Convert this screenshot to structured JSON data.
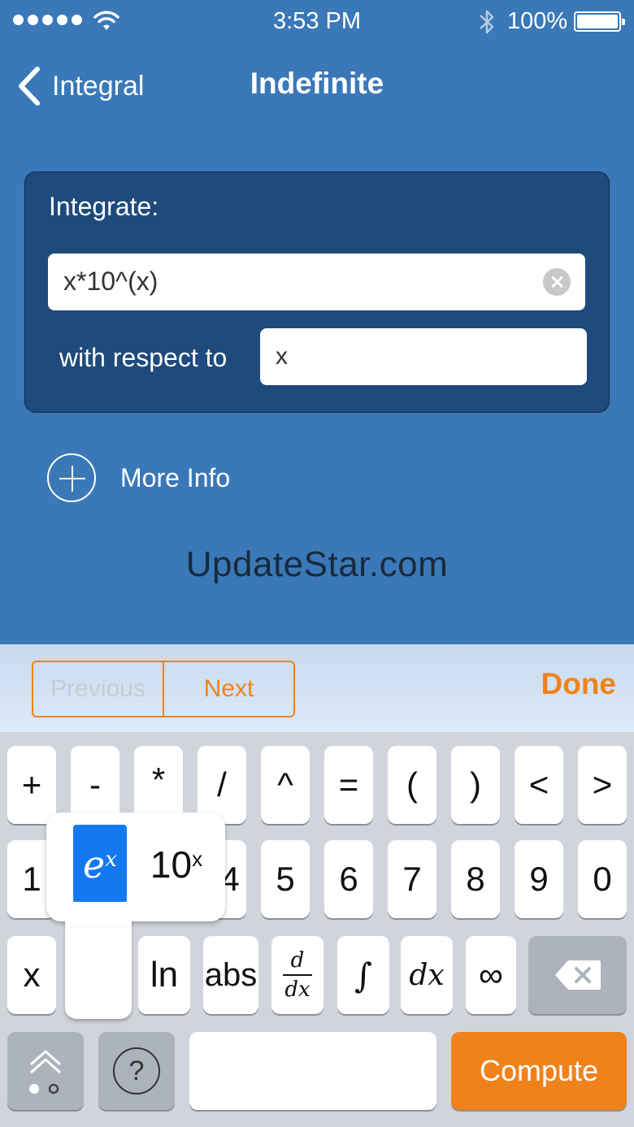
{
  "status_bar": {
    "time": "3:53 PM",
    "battery": "100%"
  },
  "nav": {
    "back_label": "Integral",
    "title": "Indefinite"
  },
  "form": {
    "label": "Integrate:",
    "expression": "x*10^(x)",
    "wrt_label": "with respect to",
    "variable": "x"
  },
  "more_info": {
    "label": "More Info"
  },
  "watermark": "UpdateStar.com",
  "toolbar": {
    "previous_label": "Previous",
    "next_label": "Next",
    "done_label": "Done"
  },
  "keyboard": {
    "row1": [
      "+",
      "-",
      "*",
      "/",
      "^",
      "=",
      "(",
      ")",
      "<",
      ">"
    ],
    "row2": [
      "1",
      "4",
      "5",
      "6",
      "7",
      "8",
      "9",
      "0"
    ],
    "row3": {
      "x": "x",
      "ln": "ln",
      "abs": "abs",
      "d": "d",
      "dx_den": "dx",
      "integral": "∫",
      "dx": "dx",
      "infinity": "∞"
    },
    "compute_label": "Compute",
    "help_label": "?"
  },
  "popup": {
    "option1_base": "e",
    "option1_exp": "x",
    "option2_base": "10",
    "option2_exp": "x"
  },
  "colors": {
    "background": "#3a78b8",
    "panel": "#1e4a7c",
    "accent": "#f0821c",
    "selected": "#1479f0"
  },
  "icons": [
    "back-chevron-icon",
    "wifi-icon",
    "bluetooth-icon",
    "battery-icon",
    "clear-icon",
    "plus-circle-icon",
    "backspace-icon",
    "keyboard-switch-icon",
    "help-icon"
  ]
}
